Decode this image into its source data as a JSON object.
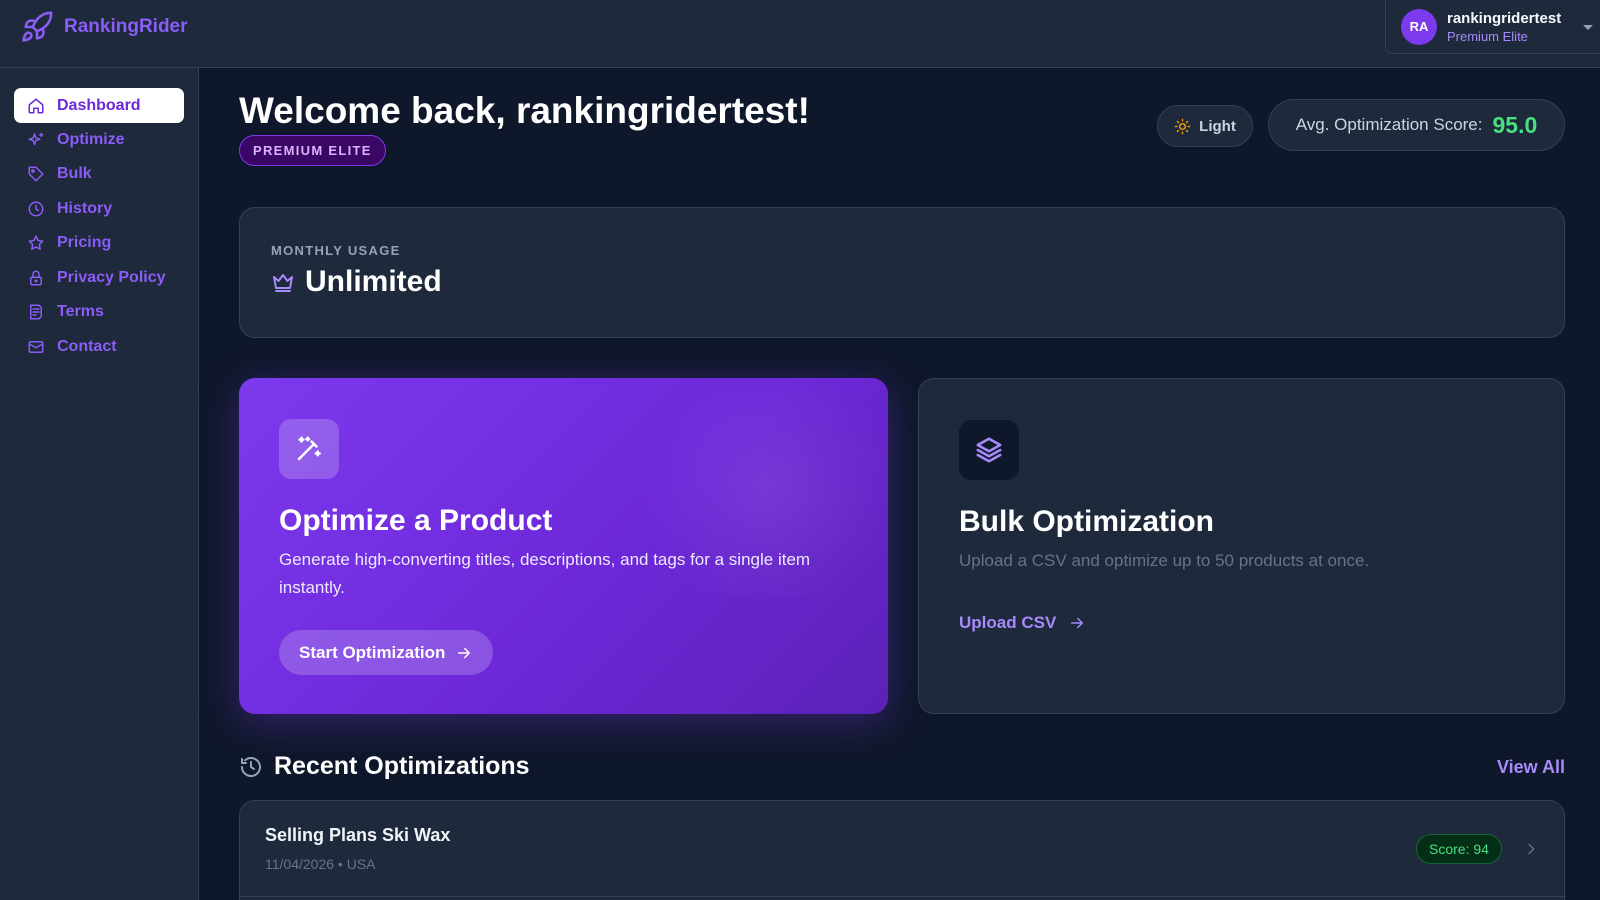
{
  "app": {
    "brand": "RankingRider",
    "accent": "#8b5cf6"
  },
  "user": {
    "initials": "RA",
    "name": "rankingridertest",
    "plan": "Premium Elite"
  },
  "sidebar": {
    "items": [
      {
        "label": "Dashboard",
        "icon": "home-icon",
        "active": true
      },
      {
        "label": "Optimize",
        "icon": "sparkles-icon",
        "active": false
      },
      {
        "label": "Bulk",
        "icon": "tag-icon",
        "active": false
      },
      {
        "label": "History",
        "icon": "clock-icon",
        "active": false
      },
      {
        "label": "Pricing",
        "icon": "star-icon",
        "active": false
      },
      {
        "label": "Privacy Policy",
        "icon": "lock-icon",
        "active": false
      },
      {
        "label": "Terms",
        "icon": "document-icon",
        "active": false
      },
      {
        "label": "Contact",
        "icon": "mail-icon",
        "active": false
      }
    ]
  },
  "header": {
    "welcome": "Welcome back, rankingridertest!",
    "plan_badge": "PREMIUM ELITE",
    "theme_toggle": "Light",
    "score_label": "Avg. Optimization Score:",
    "score_value": "95.0"
  },
  "usage": {
    "label": "MONTHLY USAGE",
    "value": "Unlimited"
  },
  "optimize_card": {
    "title": "Optimize a Product",
    "description": "Generate high-converting titles, descriptions, and tags for a single item instantly.",
    "button": "Start Optimization"
  },
  "bulk_card": {
    "title": "Bulk Optimization",
    "description": "Upload a CSV and optimize up to 50 products at once.",
    "link": "Upload CSV"
  },
  "recent": {
    "title": "Recent Optimizations",
    "view_all": "View All",
    "items": [
      {
        "title": "Selling Plans Ski Wax",
        "meta": "11/04/2026 • USA",
        "score": "Score: 94"
      }
    ]
  },
  "colors": {
    "background": "#0f172a",
    "panel": "#1e293b",
    "score_green": "#4ade80"
  }
}
